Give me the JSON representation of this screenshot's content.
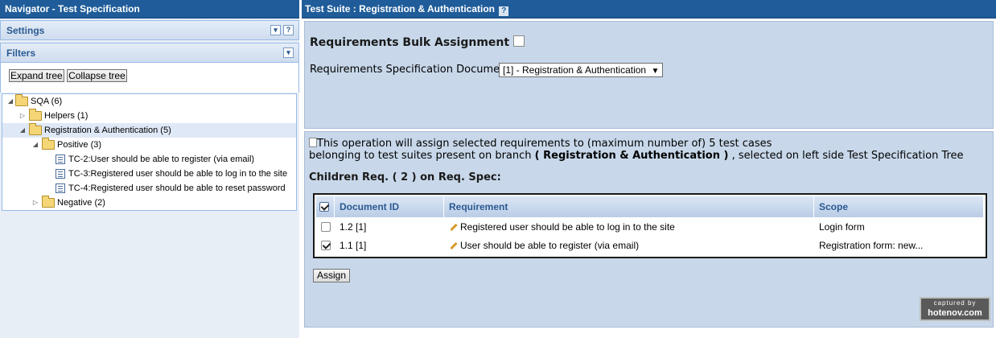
{
  "navigator": {
    "title": "Navigator - Test Specification",
    "settings_label": "Settings",
    "filters_label": "Filters",
    "help_glyph": "?",
    "expand_tree": "Expand tree",
    "collapse_tree": "Collapse tree",
    "tree": [
      {
        "label": "SQA (6)",
        "type": "folder",
        "expanded": true
      },
      {
        "label": "Helpers (1)",
        "type": "folder",
        "expanded": false
      },
      {
        "label": "Registration & Authentication (5)",
        "type": "folder",
        "expanded": true,
        "selected": true
      },
      {
        "label": "Positive (3)",
        "type": "folder",
        "expanded": true
      },
      {
        "label": "TC-2:User should be able to register (via email)",
        "type": "testcase"
      },
      {
        "label": "TC-3:Registered user should be able to log in to the site",
        "type": "testcase"
      },
      {
        "label": "TC-4:Registered user should be able to reset password",
        "type": "testcase"
      },
      {
        "label": "Negative (2)",
        "type": "folder",
        "expanded": false
      }
    ]
  },
  "main": {
    "title": "Test Suite : Registration & Authentication",
    "help_glyph": "?",
    "bulk_title": "Requirements Bulk Assignment",
    "req_spec_label": "Requirements Specification Document",
    "req_spec_selected": "[1] - Registration & Authentication",
    "info_broken_img_alt": "This operation will assign selected requirements to (maximum number of) 5 test cases",
    "info_line2_prefix": "belonging to test suites present on branch",
    "info_line2_branch": "( Registration & Authentication )",
    "info_line2_suffix": ", selected on left side Test Specification Tree",
    "children_heading": "Children Req. ( 2 ) on Req. Spec:",
    "table": {
      "headers": [
        "Document ID",
        "Requirement",
        "Scope"
      ],
      "rows": [
        {
          "checked": false,
          "doc_id": "1.2 [1]",
          "requirement": "Registered user should be able to log in to the site",
          "scope": "Login form"
        },
        {
          "checked": true,
          "doc_id": "1.1 [1]",
          "requirement": "User should be able to register (via email)",
          "scope": "Registration form: new..."
        }
      ]
    },
    "assign_button": "Assign"
  },
  "watermark": {
    "line1": "captured by",
    "line2": "hotenov.com"
  },
  "colors": {
    "title_bar": "#1f5c99",
    "panel_bg": "#c8d8ea",
    "header_text": "#2a5a92"
  }
}
